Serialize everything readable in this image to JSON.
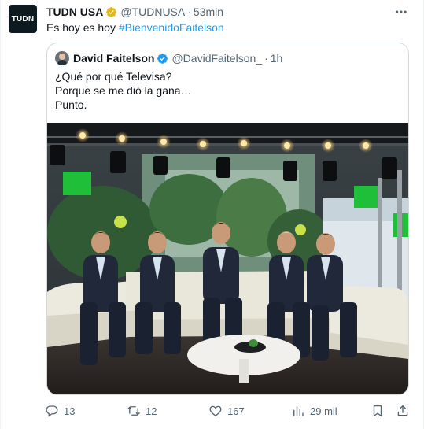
{
  "post": {
    "avatar_text": "TUDN",
    "author_name": "TUDN USA",
    "handle": "@TUDNUSA",
    "separator": "·",
    "time": "53min",
    "text_plain": "Es hoy es hoy ",
    "hashtag": "#BienvenidoFaitelson",
    "verified_icon": "gold-verified-badge-icon",
    "colors": {
      "link": "#1d9bf0",
      "verified_gold": "#e2b719",
      "verified_blue": "#1d9bf0",
      "muted": "#536471"
    }
  },
  "quote": {
    "author_name": "David Faitelson",
    "handle": "@DavidFaitelson_",
    "separator": "·",
    "time": "1h",
    "lines": [
      "¿Qué por qué Televisa?",
      "Porque se me dió la gana…",
      "Punto."
    ],
    "verified_icon": "blue-verified-badge-icon",
    "image_icon": "tv-studio-photo-five-presenters"
  },
  "actions": {
    "replies": "13",
    "reposts": "12",
    "likes": "167",
    "views": "29 mil"
  }
}
